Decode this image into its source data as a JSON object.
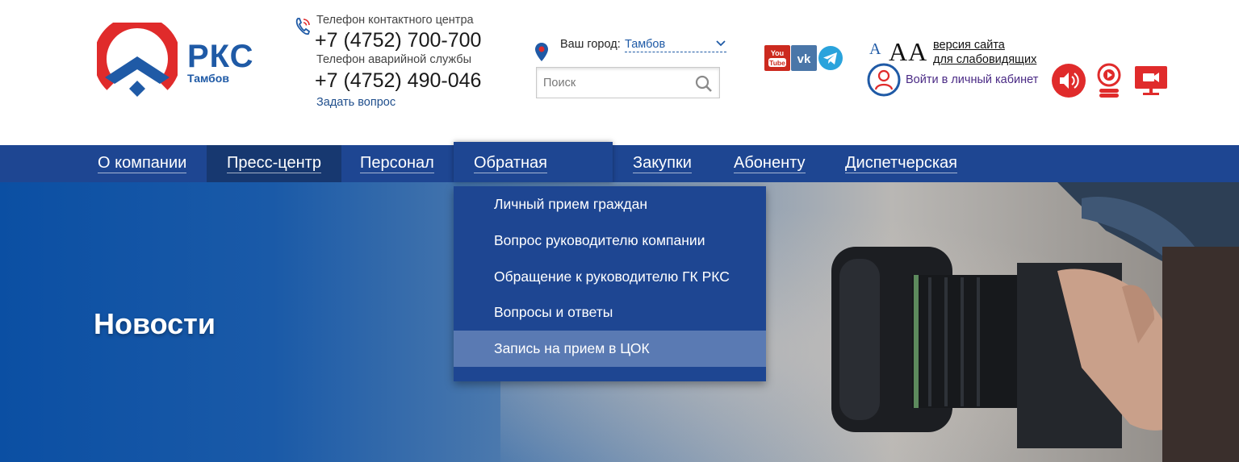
{
  "brand": {
    "name": "РКС",
    "city": "Тамбов"
  },
  "contacts": {
    "contact_label": "Телефон контактного центра",
    "contact_phone": "+7 (4752) 700-700",
    "emergency_label": "Телефон аварийной службы",
    "emergency_phone": "+7 (4752) 490-046",
    "ask_link": "Задать вопрос"
  },
  "city": {
    "label": "Ваш город:",
    "value": "Тамбов"
  },
  "search": {
    "placeholder": "Поиск"
  },
  "accessibility": {
    "font_small": "A",
    "font_large": "AA",
    "vision_line1": "версия сайта",
    "vision_line2": "для слабовидящих"
  },
  "cabinet": {
    "label": "Войти в личный кабинет"
  },
  "social": {
    "youtube_text": "You Tube",
    "vk_text": "VK"
  },
  "nav": {
    "items": [
      {
        "label": "О компании"
      },
      {
        "label": "Пресс-центр"
      },
      {
        "label": "Персонал"
      },
      {
        "label": "Обратная связь"
      },
      {
        "label": "Закупки"
      },
      {
        "label": "Абоненту"
      },
      {
        "label": "Диспетчерская"
      }
    ]
  },
  "dropdown": {
    "items": [
      {
        "label": "Личный прием граждан"
      },
      {
        "label": "Вопрос руководителю компании"
      },
      {
        "label": "Обращение к руководителю ГК РКС"
      },
      {
        "label": "Вопросы и ответы"
      },
      {
        "label": "Запись на прием в ЦОК"
      }
    ]
  },
  "hero": {
    "title": "Новости"
  },
  "colors": {
    "brand_blue": "#1f5aa6",
    "brand_red": "#e02b2b",
    "nav_bg": "#1e4692",
    "nav_active": "#173870",
    "dropdown_highlight": "#5a7ab3"
  }
}
